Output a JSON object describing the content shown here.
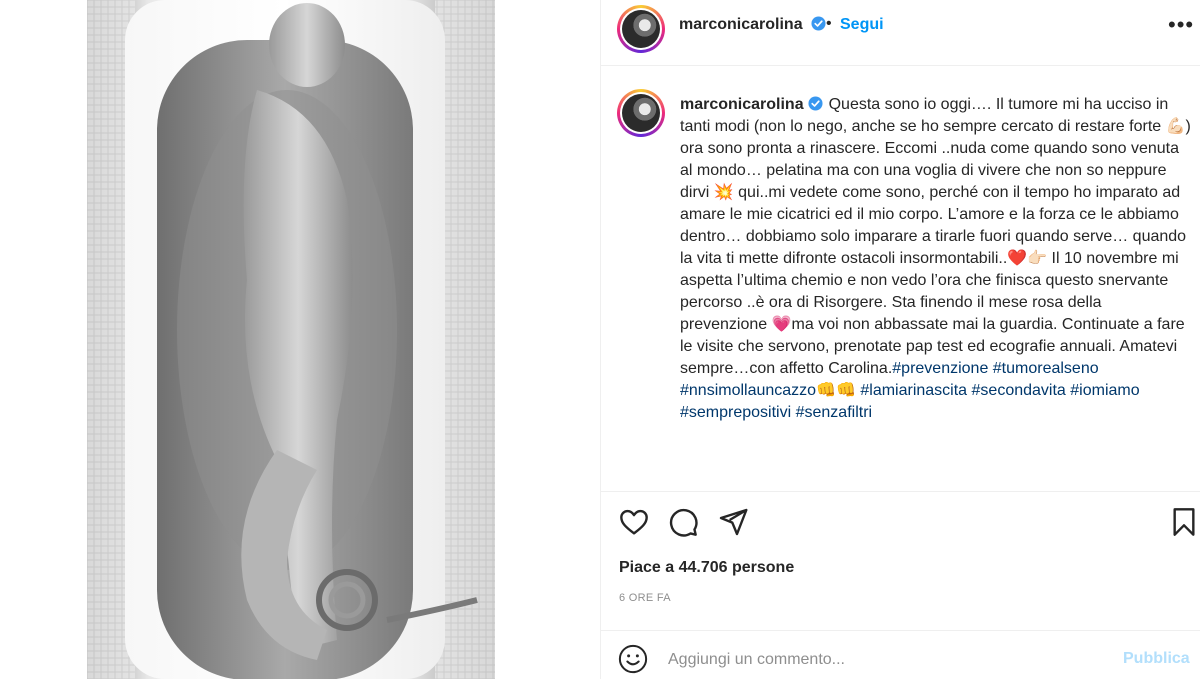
{
  "post": {
    "image_alt": "",
    "header": {
      "username": "marconicarolina",
      "separator": "•",
      "follow_label": "Segui",
      "more_label": "•••"
    },
    "caption": {
      "username": "marconicarolina",
      "text": "Questa sono io oggi…. Il tumore mi ha ucciso in tanti modi (non lo nego, anche se ho sempre cercato di restare forte 💪🏻) ora sono pronta a rinascere. Eccomi ..nuda come quando sono venuta al mondo… pelatina ma con una voglia di vivere che non so neppure dirvi 💥 qui..mi vedete come sono, perché con il tempo ho imparato ad amare le mie cicatrici ed il mio corpo. L’amore e la forza ce le abbiamo dentro… dobbiamo solo imparare a tirarle fuori quando serve… quando la vita ti mette difronte ostacoli insormontabili..❤️👉🏻 Il 10 novembre mi aspetta l’ultima chemio e non vedo l’ora che finisca questo snervante percorso ..è ora di Risorgere. Sta finendo il mese rosa della prevenzione 💗ma voi non abbassate mai la guardia. Continuate a fare le visite che servono, prenotate pap test ed ecografie annuali. Amatevi sempre…con affetto Carolina.",
      "hashtags": "#prevenzione #tumorealseno #nnsimollauncazzo👊👊 #lamiarinascita #secondavita #iomiamo #semprepositivi #senzafiltri"
    },
    "actions": {
      "like_icon": "heart-icon",
      "comment_icon": "comment-bubble-icon",
      "share_icon": "paper-plane-icon",
      "save_icon": "bookmark-icon"
    },
    "likes_text": "Piace a 44.706 persone",
    "timestamp": "6 ORE FA",
    "comment_box": {
      "placeholder": "Aggiungi un commento...",
      "publish_label": "Pubblica",
      "emoji_icon": "emoji-smiley-icon"
    }
  },
  "colors": {
    "link_blue": "#0095f6",
    "hashtag_blue": "#00376b",
    "publish_disabled": "#b2dffc",
    "verified_blue": "#3897f0",
    "muted_text": "#8e8e8e",
    "border": "#efefef"
  }
}
